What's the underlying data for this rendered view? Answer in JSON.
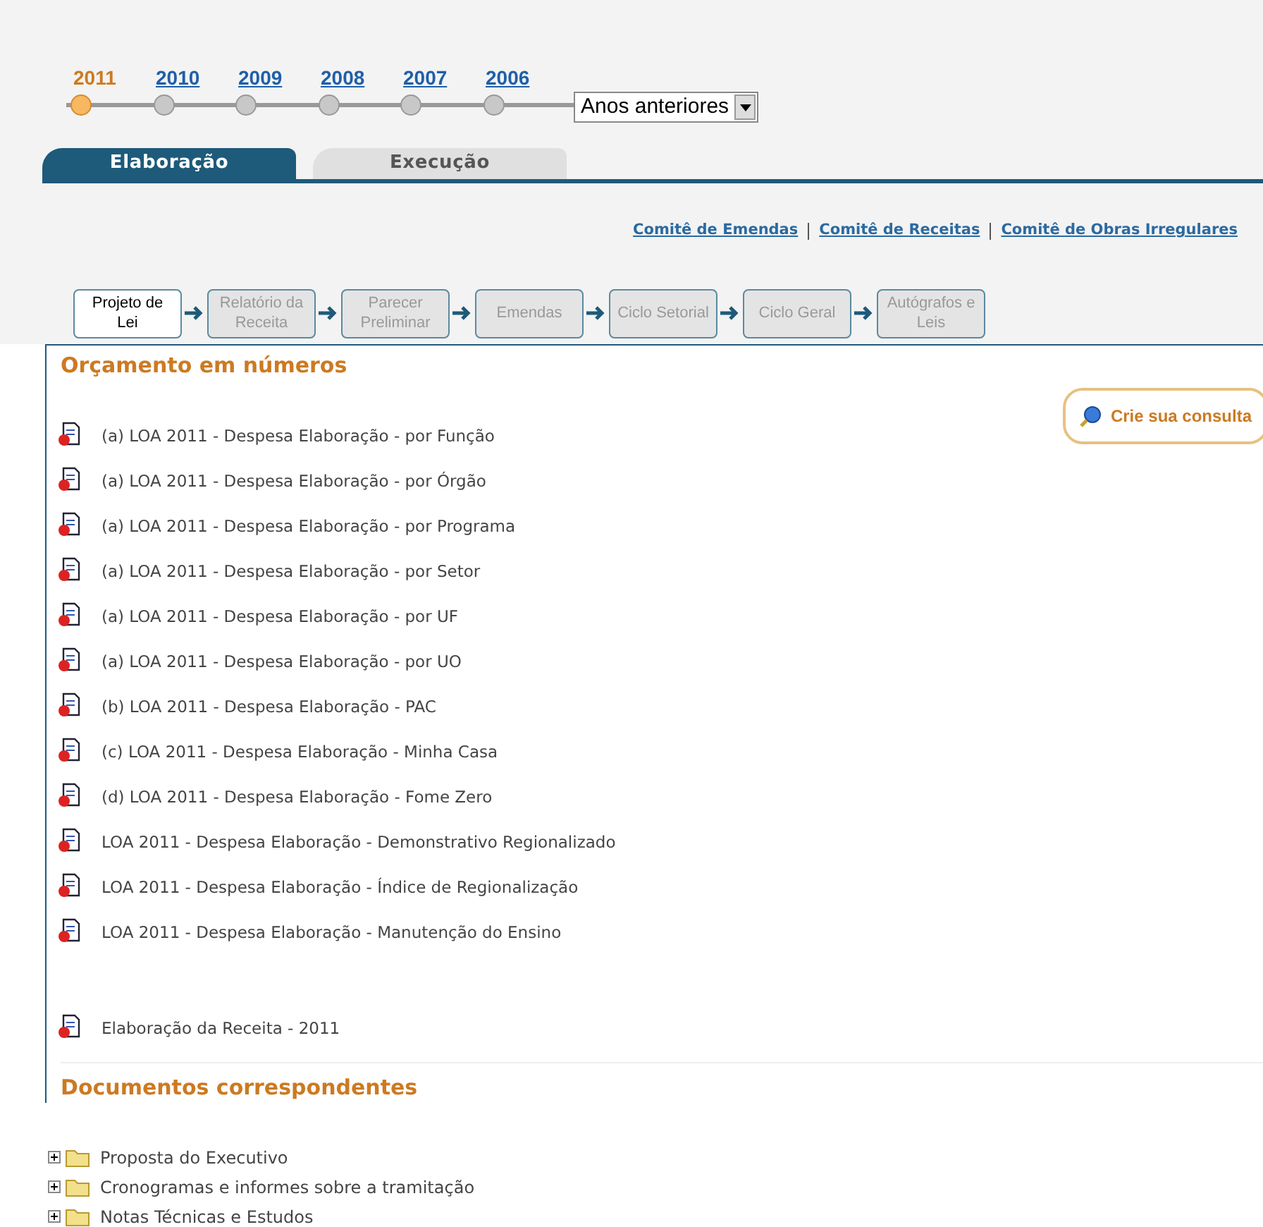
{
  "years": [
    {
      "label": "2011",
      "selected": true
    },
    {
      "label": "2010",
      "selected": false
    },
    {
      "label": "2009",
      "selected": false
    },
    {
      "label": "2008",
      "selected": false
    },
    {
      "label": "2007",
      "selected": false
    },
    {
      "label": "2006",
      "selected": false
    }
  ],
  "previous_years_select": {
    "value": "Anos anteriores"
  },
  "tabs": [
    {
      "label": "Elaboração",
      "selected": true
    },
    {
      "label": "Execução",
      "selected": false
    }
  ],
  "committee_links": [
    "Comitê de Emendas",
    "Comitê de Receitas",
    "Comitê de Obras Irregulares"
  ],
  "steps": [
    {
      "label": "Projeto de Lei",
      "selected": true
    },
    {
      "label": "Relatório da Receita",
      "selected": false
    },
    {
      "label": "Parecer Preliminar",
      "selected": false
    },
    {
      "label": "Emendas",
      "selected": false
    },
    {
      "label": "Ciclo Setorial",
      "selected": false
    },
    {
      "label": "Ciclo Geral",
      "selected": false
    },
    {
      "label": "Autógrafos e Leis",
      "selected": false
    }
  ],
  "budget_section": {
    "title": "Orçamento em números",
    "query_button": "Crie sua consulta",
    "reports": [
      "(a) LOA 2011 - Despesa Elaboração - por Função",
      "(a) LOA 2011 - Despesa Elaboração - por Órgão",
      "(a) LOA 2011 - Despesa Elaboração - por Programa",
      "(a) LOA 2011 - Despesa Elaboração - por Setor",
      "(a) LOA 2011 - Despesa Elaboração - por UF",
      "(a) LOA 2011 - Despesa Elaboração - por UO",
      "(b) LOA 2011 - Despesa Elaboração - PAC",
      "(c) LOA 2011 - Despesa Elaboração - Minha Casa",
      "(d) LOA 2011 - Despesa Elaboração - Fome Zero",
      "LOA 2011 - Despesa Elaboração - Demonstrativo Regionalizado",
      "LOA 2011 - Despesa Elaboração - Índice de Regionalização",
      "LOA 2011 - Despesa Elaboração - Manutenção do Ensino"
    ],
    "revenue_reports": [
      "Elaboração da Receita - 2011"
    ]
  },
  "documents_section": {
    "title": "Documentos correspondentes",
    "folders": [
      {
        "label": "Proposta do Executivo",
        "expanded": false
      },
      {
        "label": "Cronogramas e informes sobre a tramitação",
        "expanded": false
      },
      {
        "label": "Notas Técnicas e Estudos",
        "expanded": false
      }
    ]
  }
}
